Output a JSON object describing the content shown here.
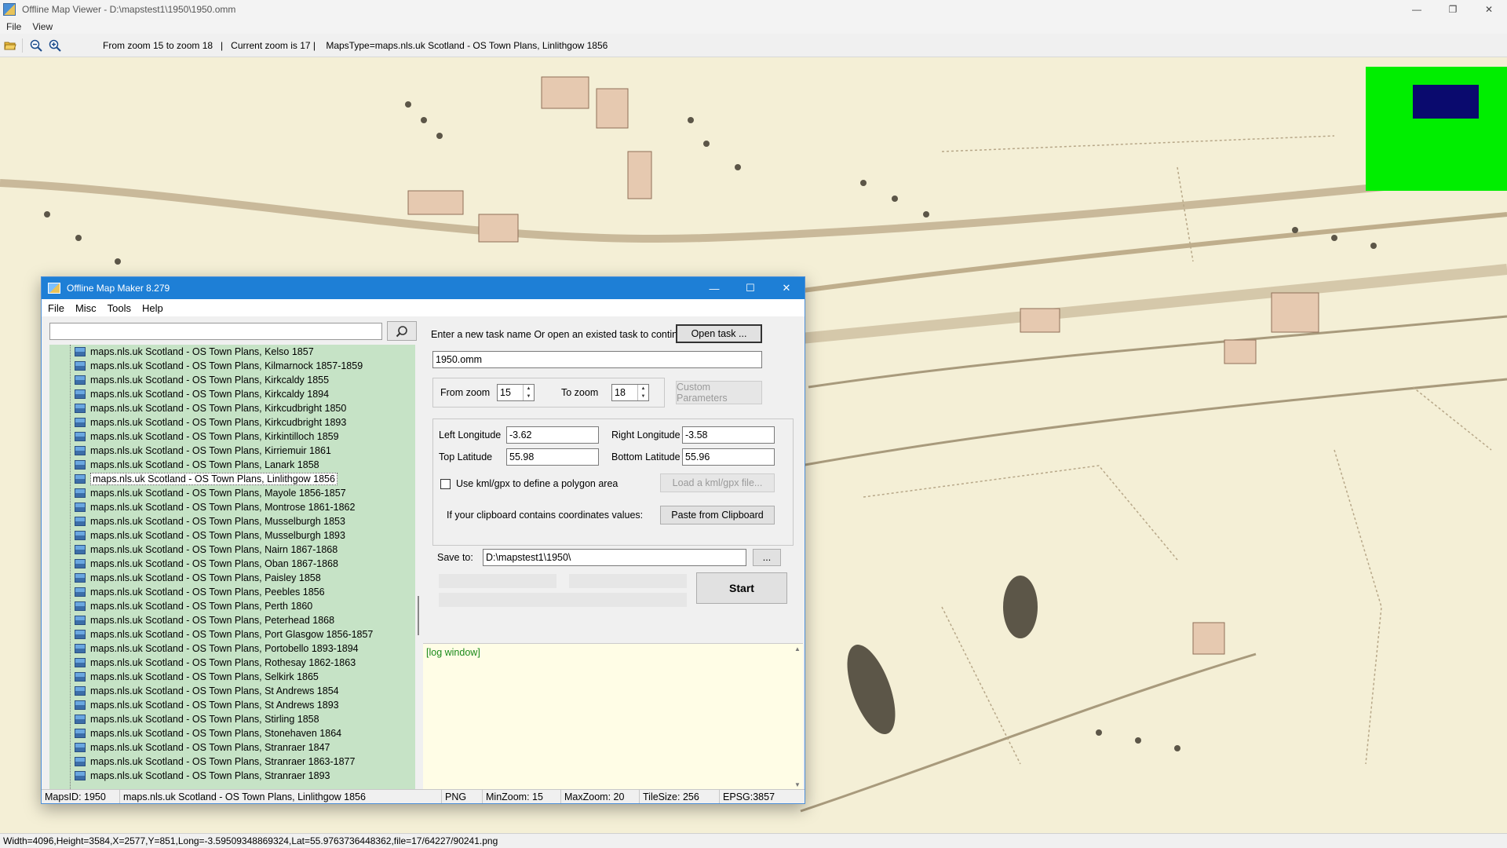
{
  "window": {
    "title": "Offline Map Viewer - D:\\mapstest1\\1950\\1950.omm",
    "controls": {
      "minimize": "—",
      "restore": "❐",
      "close": "✕"
    }
  },
  "menu": {
    "file": "File",
    "view": "View"
  },
  "toolbar": {
    "info": "From zoom 15 to zoom 18   |   Current zoom is 17 |    MapsType=maps.nls.uk Scotland - OS Town Plans, Linlithgow 1856"
  },
  "status_bar": {
    "text": "Width=4096,Height=3584,X=2577,Y=851,Long=-3.59509348869324,Lat=55.9763736448362,file=17/64227/90241.png"
  },
  "colors": {
    "map_background": "#f4efd6",
    "minimap": "#00ee00",
    "minimap_viewport": "#0a0a6e",
    "tree_background": "#c6e3c6",
    "dialog_titlebar": "#1e7fd6",
    "log_text": "#1a8a1a",
    "log_background": "#fffde6"
  },
  "dialog": {
    "title": "Offline Map Maker 8.279",
    "menu": {
      "file": "File",
      "misc": "Misc",
      "tools": "Tools",
      "help": "Help"
    },
    "search": {
      "value": ""
    },
    "tree": {
      "selected_index": 9,
      "items": [
        "maps.nls.uk Scotland - OS Town Plans, Kelso 1857",
        "maps.nls.uk Scotland - OS Town Plans, Kilmarnock 1857-1859",
        "maps.nls.uk Scotland - OS Town Plans, Kirkcaldy 1855",
        "maps.nls.uk Scotland - OS Town Plans, Kirkcaldy 1894",
        "maps.nls.uk Scotland - OS Town Plans, Kirkcudbright 1850",
        "maps.nls.uk Scotland - OS Town Plans, Kirkcudbright 1893",
        "maps.nls.uk Scotland - OS Town Plans, Kirkintilloch 1859",
        "maps.nls.uk Scotland - OS Town Plans, Kirriemuir 1861",
        "maps.nls.uk Scotland - OS Town Plans, Lanark 1858",
        "maps.nls.uk Scotland - OS Town Plans, Linlithgow 1856",
        "maps.nls.uk Scotland - OS Town Plans, Mayole 1856-1857",
        "maps.nls.uk Scotland - OS Town Plans, Montrose 1861-1862",
        "maps.nls.uk Scotland - OS Town Plans, Musselburgh 1853",
        "maps.nls.uk Scotland - OS Town Plans, Musselburgh 1893",
        "maps.nls.uk Scotland - OS Town Plans, Nairn 1867-1868",
        "maps.nls.uk Scotland - OS Town Plans, Oban 1867-1868",
        "maps.nls.uk Scotland - OS Town Plans, Paisley 1858",
        "maps.nls.uk Scotland - OS Town Plans, Peebles 1856",
        "maps.nls.uk Scotland - OS Town Plans, Perth 1860",
        "maps.nls.uk Scotland - OS Town Plans, Peterhead 1868",
        "maps.nls.uk Scotland - OS Town Plans, Port Glasgow 1856-1857",
        "maps.nls.uk Scotland - OS Town Plans, Portobello 1893-1894",
        "maps.nls.uk Scotland - OS Town Plans, Rothesay 1862-1863",
        "maps.nls.uk Scotland - OS Town Plans, Selkirk 1865",
        "maps.nls.uk Scotland - OS Town Plans, St Andrews 1854",
        "maps.nls.uk Scotland - OS Town Plans, St Andrews 1893",
        "maps.nls.uk Scotland - OS Town Plans, Stirling 1858",
        "maps.nls.uk Scotland - OS Town Plans, Stonehaven 1864",
        "maps.nls.uk Scotland - OS Town Plans, Stranraer 1847",
        "maps.nls.uk Scotland - OS Town Plans, Stranraer 1863-1877",
        "maps.nls.uk Scotland - OS Town Plans, Stranraer 1893"
      ]
    },
    "task": {
      "prompt": "Enter a new task name Or open an existed task to continue:",
      "open_button": "Open task ...",
      "name_value": "1950.omm"
    },
    "zoom": {
      "from_label": "From zoom",
      "from_value": "15",
      "to_label": "To zoom",
      "to_value": "18",
      "custom_button": "Custom Parameters"
    },
    "coords": {
      "left_lon_label": "Left Longitude",
      "left_lon_value": "-3.62",
      "right_lon_label": "Right Longitude",
      "right_lon_value": "-3.58",
      "top_lat_label": "Top Latitude",
      "top_lat_value": "55.98",
      "bottom_lat_label": "Bottom Latitude",
      "bottom_lat_value": "55.96",
      "kml_label": "Use kml/gpx to define a polygon area",
      "kml_checked": false,
      "load_kml_button": "Load a kml/gpx file...",
      "clipboard_label": "If your clipboard contains coordinates values:",
      "paste_button": "Paste from Clipboard"
    },
    "save": {
      "label": "Save to:",
      "path_value": "D:\\mapstest1\\1950\\",
      "browse_button": "...",
      "start_button": "Start"
    },
    "log": {
      "text": "[log window]"
    },
    "status": {
      "maps_id": "MapsID: 1950",
      "map_name": "maps.nls.uk Scotland - OS Town Plans, Linlithgow 1856",
      "format": "PNG",
      "min_zoom": "MinZoom: 15",
      "max_zoom": "MaxZoom: 20",
      "tile_size": "TileSize: 256",
      "epsg": "EPSG:3857"
    }
  }
}
